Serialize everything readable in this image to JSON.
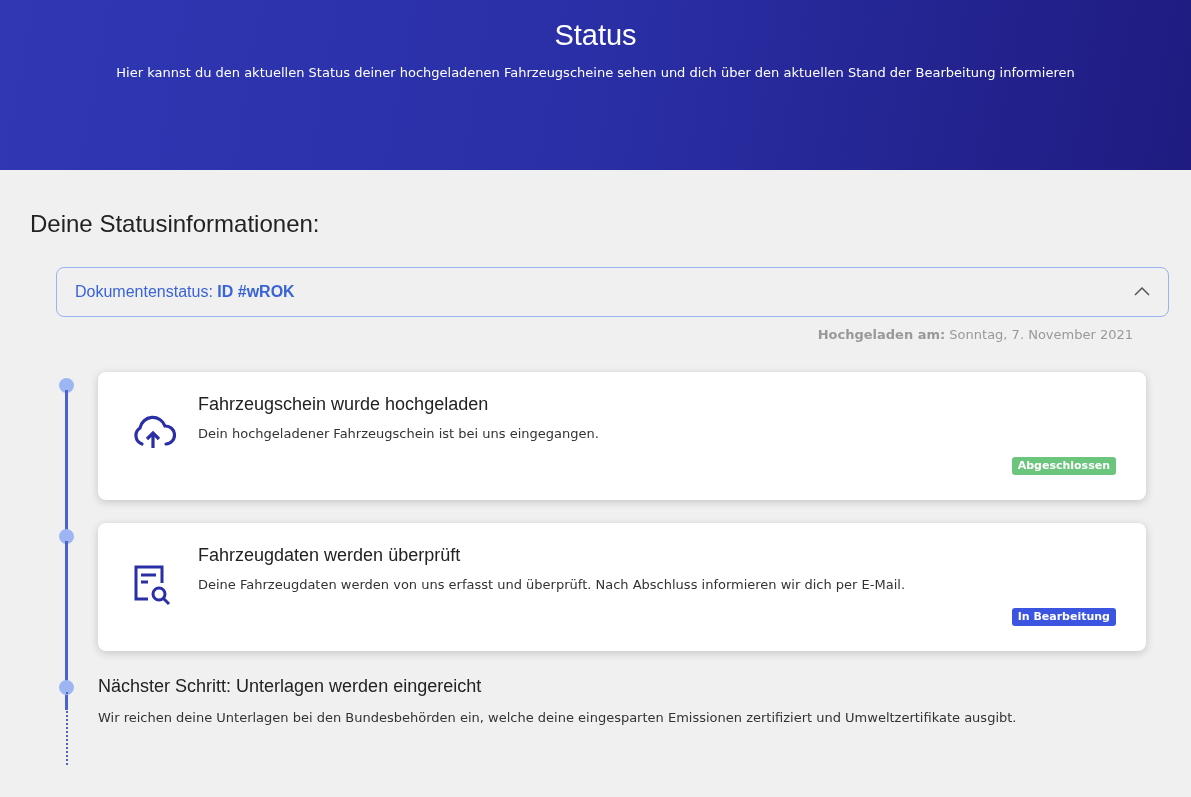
{
  "header": {
    "title": "Status",
    "subtitle": "Hier kannst du den aktuellen Status deiner hochgeladenen Fahrzeugscheine sehen und dich über den aktuellen Stand der Bearbeitung informieren"
  },
  "section_title": "Deine Statusinformationen:",
  "document": {
    "label": "Dokumentenstatus: **ID #wROK**",
    "expanded": true,
    "uploaded_label": "Hochgeladen am:",
    "uploaded_date": "Sonntag, 7. November 2021"
  },
  "steps": [
    {
      "kind": "card",
      "title": "Fahrzeugschein wurde hochgeladen",
      "text": "Dein hochgeladener Fahrzeugschein ist bei uns eingegangen.",
      "badge": "Abgeschlossen",
      "color": "#6cc57c"
    },
    {
      "kind": "card",
      "title": "Fahrzeugdaten werden überprüft",
      "text": "Deine Fahrzeugdaten werden von uns erfasst und überprüft. Nach Abschluss informieren wir dich per E-Mail.",
      "badge": "In Bearbeitung",
      "color": "#3b55e0"
    },
    {
      "kind": "plain",
      "title": "Nächster Schritt: Unterlagen werden eingereicht",
      "text": "Wir reichen deine Unterlagen bei den Bundesbehörden ein, welche deine eingesparten Emissionen zertifiziert und Umweltzertifikate ausgibt."
    }
  ]
}
